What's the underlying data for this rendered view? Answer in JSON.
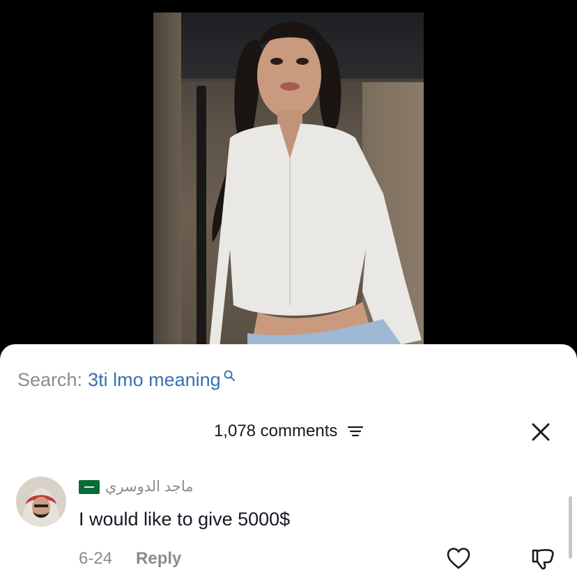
{
  "search": {
    "prefix": "Search:",
    "term": "3ti lmo meaning",
    "icon": "search-icon"
  },
  "comments_header": {
    "count_label": "1,078 comments",
    "filter_icon": "filter-icon",
    "close_icon": "close-icon"
  },
  "comment": {
    "username": "ماجد الدوسري",
    "flag_icon": "saudi-flag-icon",
    "text": "I would like to give 5000$",
    "date": "6-24",
    "reply_label": "Reply",
    "like_icon": "heart-icon",
    "dislike_icon": "thumbs-down-icon"
  },
  "colors": {
    "search_term": "#3a6fb3",
    "muted_text": "#8a8b91",
    "primary_text": "#161823",
    "panel_bg": "#ffffff",
    "background": "#000000"
  }
}
